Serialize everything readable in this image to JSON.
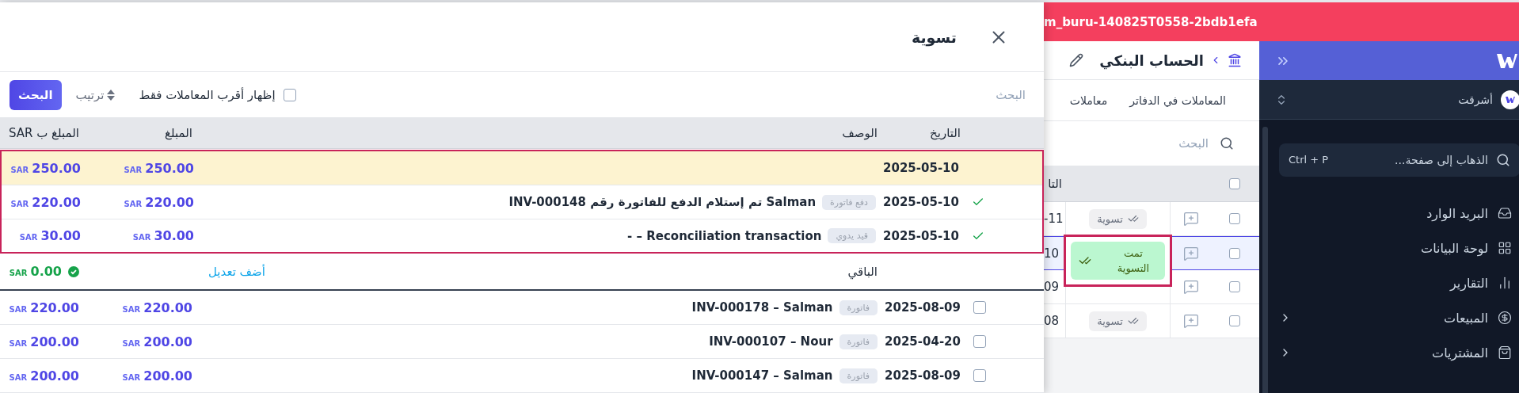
{
  "dialog": {
    "title": "تسوية",
    "search": {
      "placeholder": "البحث"
    },
    "closest_only": {
      "label": "إظهار أقرب المعاملات فقط",
      "checked": false
    },
    "sort": {
      "label": "ترتيب"
    },
    "search_button": "البحث",
    "columns": [
      "التاريخ",
      "الوصف",
      "المبلغ",
      "المبلغ ب SAR"
    ],
    "matched_rows": [
      {
        "highlighted": true,
        "checked": false,
        "date": "2025-05-10",
        "amount": "250.00",
        "amount_currency": "SAR",
        "amount_sar": "250.00",
        "amount_sar_currency": "SAR"
      },
      {
        "highlighted": false,
        "checked": true,
        "date": "2025-05-10",
        "tag": "دفع فاتورة",
        "description": "Salman تم إستلام الدفع للفاتورة رقم INV-000148",
        "amount": "220.00",
        "amount_currency": "SAR",
        "amount_sar": "220.00",
        "amount_sar_currency": "SAR"
      },
      {
        "highlighted": false,
        "checked": true,
        "date": "2025-05-10",
        "tag": "قيد يدوي",
        "description": "Reconciliation transaction – -",
        "amount": "30.00",
        "amount_currency": "SAR",
        "amount_sar": "30.00",
        "amount_sar_currency": "SAR"
      }
    ],
    "remaining": {
      "label": "الباقي",
      "adjust_link": "أضف تعديل",
      "amount": "0.00",
      "currency": "SAR",
      "balanced": true
    },
    "candidate_rows": [
      {
        "checked": false,
        "date": "2025-08-09",
        "tag": "فاتورة",
        "description": "INV-000178 – Salman",
        "amount": "220.00",
        "amount_currency": "SAR",
        "amount_sar": "220.00",
        "amount_sar_currency": "SAR"
      },
      {
        "checked": false,
        "date": "2025-04-20",
        "tag": "فاتورة",
        "description": "INV-000107 – Nour",
        "amount": "200.00",
        "amount_currency": "SAR",
        "amount_sar": "200.00",
        "amount_sar_currency": "SAR"
      },
      {
        "checked": false,
        "date": "2025-08-09",
        "tag": "فاتورة",
        "description": "INV-000147 – Salman",
        "amount": "200.00",
        "amount_currency": "SAR",
        "amount_sar": "200.00",
        "amount_sar_currency": "SAR"
      }
    ]
  },
  "environment_banner": "m_buru-140825T0558-2bdb1efa",
  "page": {
    "title": "الحساب البنكي",
    "tabs": [
      "المعاملات في الدفاتر",
      "معاملات"
    ],
    "search": {
      "placeholder": "البحث"
    },
    "table": {
      "columns": [
        "التا"
      ],
      "select_all_checked": false,
      "rows": [
        {
          "selected": false,
          "checked": false,
          "status": "تسوية",
          "date": "-11"
        },
        {
          "selected": true,
          "checked": false,
          "date": "10"
        },
        {
          "selected": false,
          "checked": false,
          "date": "09"
        },
        {
          "selected": false,
          "checked": false,
          "status": "تسوية",
          "date": "08"
        }
      ]
    },
    "popup": {
      "label": "تمت التسوية"
    }
  },
  "sidebar": {
    "company": "أشرقت",
    "search": {
      "placeholder": "الذهاب إلى صفحة...",
      "shortcut": "Ctrl + P"
    },
    "nav": [
      {
        "label": "البريد الوارد",
        "kind": "link"
      },
      {
        "label": "لوحة البيانات",
        "kind": "link"
      },
      {
        "label": "التقارير",
        "kind": "link"
      },
      {
        "label": "المبيعات",
        "kind": "group"
      },
      {
        "label": "المشتريات",
        "kind": "group"
      }
    ]
  }
}
